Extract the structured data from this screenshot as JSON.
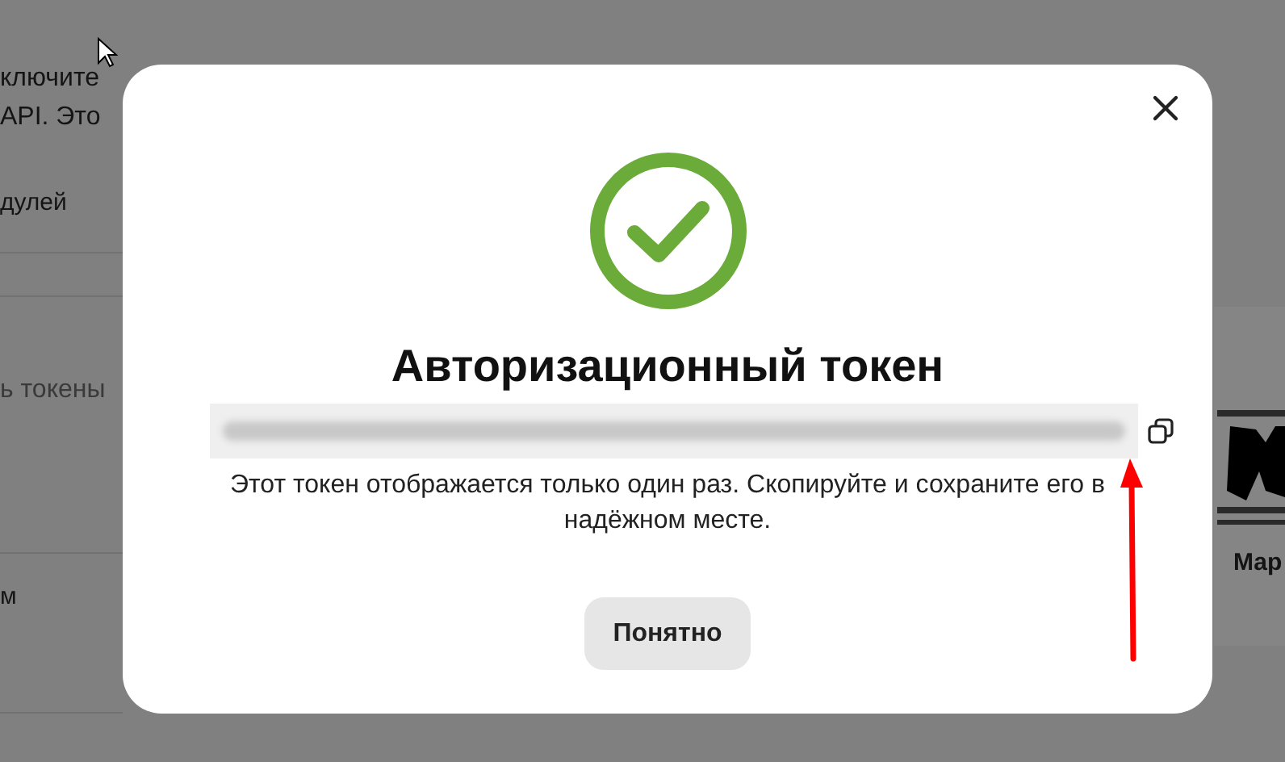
{
  "background": {
    "notice_lines": [
      "ключите",
      "API. Это"
    ],
    "tab": "дулей",
    "token_hint": "ь токены",
    "list_item": "м",
    "card_label": "Мар"
  },
  "dialog": {
    "title": "Авторизационный токен",
    "description": "Этот токен отображается только один раз. Скопируйте и сохраните его в надёжном месте.",
    "button": "Понятно"
  }
}
